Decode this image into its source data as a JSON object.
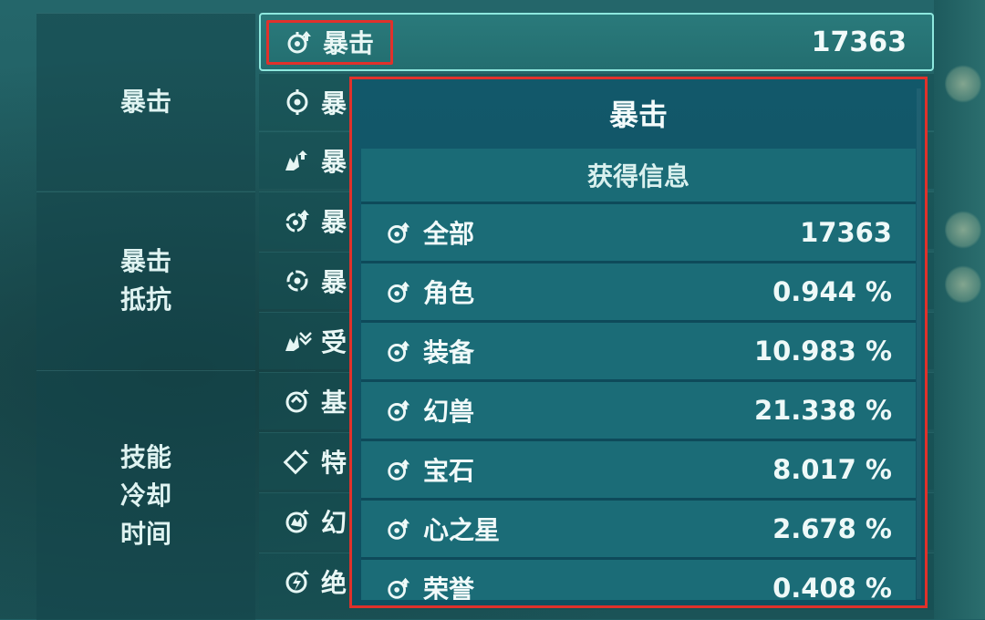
{
  "left_groups": [
    {
      "lines": [
        "暴击"
      ]
    },
    {
      "lines": [
        "暴击",
        "抵抗"
      ]
    },
    {
      "lines": [
        "技能",
        "冷却",
        "时间"
      ]
    }
  ],
  "stat_rows": [
    {
      "icon": "crit-up-icon",
      "label": "暴击",
      "value": "17363",
      "active": true
    },
    {
      "icon": "crit-target-icon",
      "label": "暴"
    },
    {
      "icon": "crit-beast-icon",
      "label": "暴"
    },
    {
      "icon": "crit-resist-up-icon",
      "label": "暴"
    },
    {
      "icon": "crit-resist-icon",
      "label": "暴"
    },
    {
      "icon": "damage-taken-icon",
      "label": "受"
    },
    {
      "icon": "cooldown-basic-icon",
      "label": "基"
    },
    {
      "icon": "cooldown-special-icon",
      "label": "特"
    },
    {
      "icon": "cooldown-beast-icon",
      "label": "幻"
    },
    {
      "icon": "cooldown-ultimate-icon",
      "label": "绝"
    }
  ],
  "popup": {
    "title": "暴击",
    "section_header": "获得信息",
    "items": [
      {
        "name": "全部",
        "value": "17363"
      },
      {
        "name": "角色",
        "value": "0.944 %"
      },
      {
        "name": "装备",
        "value": "10.983 %"
      },
      {
        "name": "幻兽",
        "value": "21.338 %"
      },
      {
        "name": "宝石",
        "value": "8.017 %"
      },
      {
        "name": "心之星",
        "value": "2.678 %"
      },
      {
        "name": "荣誉",
        "value": "0.408 %"
      }
    ]
  },
  "colors": {
    "highlight": "#e0312b",
    "active_border": "#8ee8de",
    "panel": "#0f4f60"
  }
}
